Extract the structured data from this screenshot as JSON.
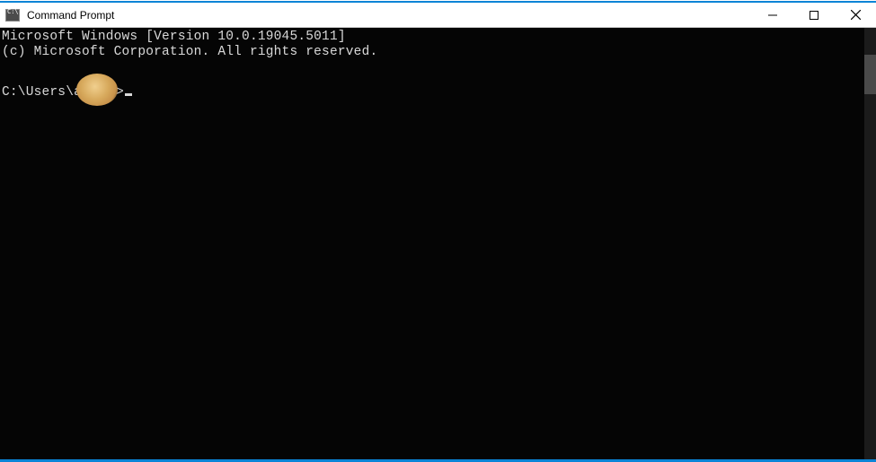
{
  "window": {
    "title": "Command Prompt"
  },
  "terminal": {
    "banner_line1": "Microsoft Windows [Version 10.0.19045.5011]",
    "banner_line2": "(c) Microsoft Corporation. All rights reserved.",
    "prompt_prefix": "C:\\Users\\a",
    "prompt_suffix": ">"
  }
}
